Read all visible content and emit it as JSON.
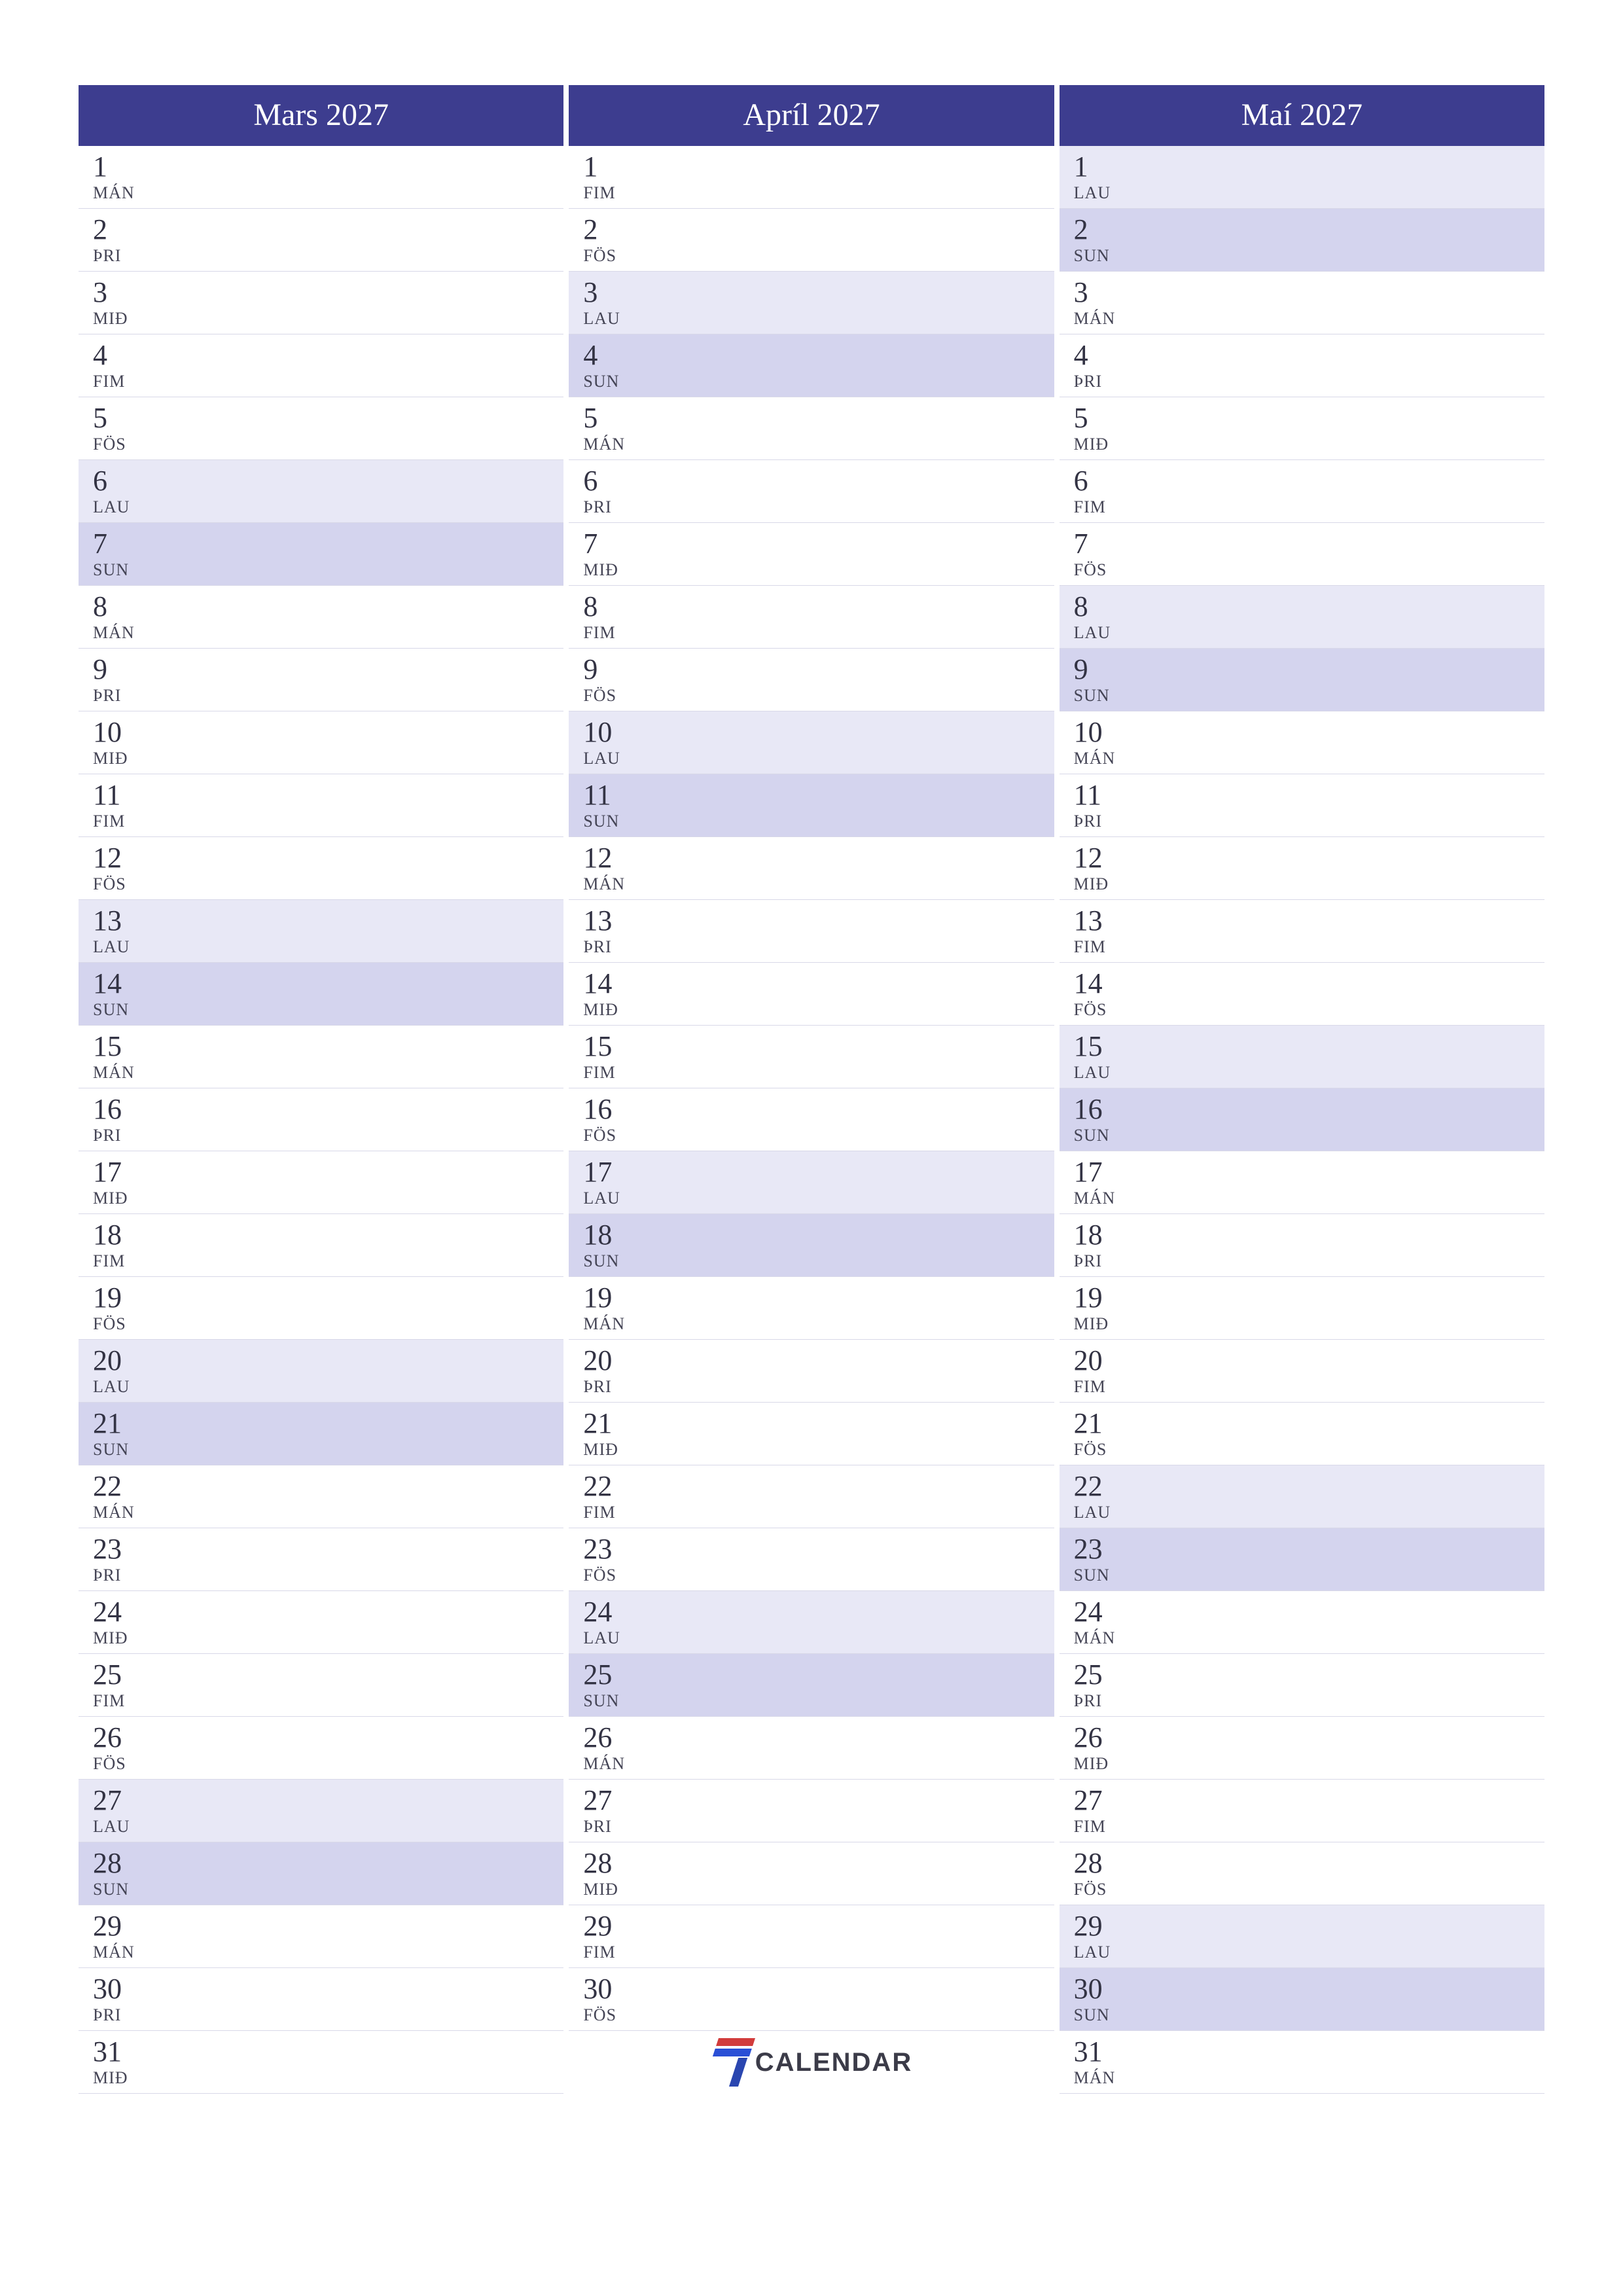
{
  "colors": {
    "header_bg": "#3d3d8f",
    "sat_bg": "#e8e8f6",
    "sun_bg": "#d4d4ee"
  },
  "day_labels": {
    "mon": "MÁN",
    "tue": "ÞRI",
    "wed": "MIÐ",
    "thu": "FIM",
    "fri": "FÖS",
    "sat": "LAU",
    "sun": "SUN"
  },
  "logo_text": "CALENDAR",
  "months": [
    {
      "title": "Mars 2027",
      "days": [
        {
          "n": "1",
          "d": "MÁN",
          "t": "weekday"
        },
        {
          "n": "2",
          "d": "ÞRI",
          "t": "weekday"
        },
        {
          "n": "3",
          "d": "MIÐ",
          "t": "weekday"
        },
        {
          "n": "4",
          "d": "FIM",
          "t": "weekday"
        },
        {
          "n": "5",
          "d": "FÖS",
          "t": "weekday"
        },
        {
          "n": "6",
          "d": "LAU",
          "t": "sat"
        },
        {
          "n": "7",
          "d": "SUN",
          "t": "sun"
        },
        {
          "n": "8",
          "d": "MÁN",
          "t": "weekday"
        },
        {
          "n": "9",
          "d": "ÞRI",
          "t": "weekday"
        },
        {
          "n": "10",
          "d": "MIÐ",
          "t": "weekday"
        },
        {
          "n": "11",
          "d": "FIM",
          "t": "weekday"
        },
        {
          "n": "12",
          "d": "FÖS",
          "t": "weekday"
        },
        {
          "n": "13",
          "d": "LAU",
          "t": "sat"
        },
        {
          "n": "14",
          "d": "SUN",
          "t": "sun"
        },
        {
          "n": "15",
          "d": "MÁN",
          "t": "weekday"
        },
        {
          "n": "16",
          "d": "ÞRI",
          "t": "weekday"
        },
        {
          "n": "17",
          "d": "MIÐ",
          "t": "weekday"
        },
        {
          "n": "18",
          "d": "FIM",
          "t": "weekday"
        },
        {
          "n": "19",
          "d": "FÖS",
          "t": "weekday"
        },
        {
          "n": "20",
          "d": "LAU",
          "t": "sat"
        },
        {
          "n": "21",
          "d": "SUN",
          "t": "sun"
        },
        {
          "n": "22",
          "d": "MÁN",
          "t": "weekday"
        },
        {
          "n": "23",
          "d": "ÞRI",
          "t": "weekday"
        },
        {
          "n": "24",
          "d": "MIÐ",
          "t": "weekday"
        },
        {
          "n": "25",
          "d": "FIM",
          "t": "weekday"
        },
        {
          "n": "26",
          "d": "FÖS",
          "t": "weekday"
        },
        {
          "n": "27",
          "d": "LAU",
          "t": "sat"
        },
        {
          "n": "28",
          "d": "SUN",
          "t": "sun"
        },
        {
          "n": "29",
          "d": "MÁN",
          "t": "weekday"
        },
        {
          "n": "30",
          "d": "ÞRI",
          "t": "weekday"
        },
        {
          "n": "31",
          "d": "MIÐ",
          "t": "weekday"
        }
      ]
    },
    {
      "title": "Apríl 2027",
      "days": [
        {
          "n": "1",
          "d": "FIM",
          "t": "weekday"
        },
        {
          "n": "2",
          "d": "FÖS",
          "t": "weekday"
        },
        {
          "n": "3",
          "d": "LAU",
          "t": "sat"
        },
        {
          "n": "4",
          "d": "SUN",
          "t": "sun"
        },
        {
          "n": "5",
          "d": "MÁN",
          "t": "weekday"
        },
        {
          "n": "6",
          "d": "ÞRI",
          "t": "weekday"
        },
        {
          "n": "7",
          "d": "MIÐ",
          "t": "weekday"
        },
        {
          "n": "8",
          "d": "FIM",
          "t": "weekday"
        },
        {
          "n": "9",
          "d": "FÖS",
          "t": "weekday"
        },
        {
          "n": "10",
          "d": "LAU",
          "t": "sat"
        },
        {
          "n": "11",
          "d": "SUN",
          "t": "sun"
        },
        {
          "n": "12",
          "d": "MÁN",
          "t": "weekday"
        },
        {
          "n": "13",
          "d": "ÞRI",
          "t": "weekday"
        },
        {
          "n": "14",
          "d": "MIÐ",
          "t": "weekday"
        },
        {
          "n": "15",
          "d": "FIM",
          "t": "weekday"
        },
        {
          "n": "16",
          "d": "FÖS",
          "t": "weekday"
        },
        {
          "n": "17",
          "d": "LAU",
          "t": "sat"
        },
        {
          "n": "18",
          "d": "SUN",
          "t": "sun"
        },
        {
          "n": "19",
          "d": "MÁN",
          "t": "weekday"
        },
        {
          "n": "20",
          "d": "ÞRI",
          "t": "weekday"
        },
        {
          "n": "21",
          "d": "MIÐ",
          "t": "weekday"
        },
        {
          "n": "22",
          "d": "FIM",
          "t": "weekday"
        },
        {
          "n": "23",
          "d": "FÖS",
          "t": "weekday"
        },
        {
          "n": "24",
          "d": "LAU",
          "t": "sat"
        },
        {
          "n": "25",
          "d": "SUN",
          "t": "sun"
        },
        {
          "n": "26",
          "d": "MÁN",
          "t": "weekday"
        },
        {
          "n": "27",
          "d": "ÞRI",
          "t": "weekday"
        },
        {
          "n": "28",
          "d": "MIÐ",
          "t": "weekday"
        },
        {
          "n": "29",
          "d": "FIM",
          "t": "weekday"
        },
        {
          "n": "30",
          "d": "FÖS",
          "t": "weekday"
        }
      ]
    },
    {
      "title": "Maí 2027",
      "days": [
        {
          "n": "1",
          "d": "LAU",
          "t": "sat"
        },
        {
          "n": "2",
          "d": "SUN",
          "t": "sun"
        },
        {
          "n": "3",
          "d": "MÁN",
          "t": "weekday"
        },
        {
          "n": "4",
          "d": "ÞRI",
          "t": "weekday"
        },
        {
          "n": "5",
          "d": "MIÐ",
          "t": "weekday"
        },
        {
          "n": "6",
          "d": "FIM",
          "t": "weekday"
        },
        {
          "n": "7",
          "d": "FÖS",
          "t": "weekday"
        },
        {
          "n": "8",
          "d": "LAU",
          "t": "sat"
        },
        {
          "n": "9",
          "d": "SUN",
          "t": "sun"
        },
        {
          "n": "10",
          "d": "MÁN",
          "t": "weekday"
        },
        {
          "n": "11",
          "d": "ÞRI",
          "t": "weekday"
        },
        {
          "n": "12",
          "d": "MIÐ",
          "t": "weekday"
        },
        {
          "n": "13",
          "d": "FIM",
          "t": "weekday"
        },
        {
          "n": "14",
          "d": "FÖS",
          "t": "weekday"
        },
        {
          "n": "15",
          "d": "LAU",
          "t": "sat"
        },
        {
          "n": "16",
          "d": "SUN",
          "t": "sun"
        },
        {
          "n": "17",
          "d": "MÁN",
          "t": "weekday"
        },
        {
          "n": "18",
          "d": "ÞRI",
          "t": "weekday"
        },
        {
          "n": "19",
          "d": "MIÐ",
          "t": "weekday"
        },
        {
          "n": "20",
          "d": "FIM",
          "t": "weekday"
        },
        {
          "n": "21",
          "d": "FÖS",
          "t": "weekday"
        },
        {
          "n": "22",
          "d": "LAU",
          "t": "sat"
        },
        {
          "n": "23",
          "d": "SUN",
          "t": "sun"
        },
        {
          "n": "24",
          "d": "MÁN",
          "t": "weekday"
        },
        {
          "n": "25",
          "d": "ÞRI",
          "t": "weekday"
        },
        {
          "n": "26",
          "d": "MIÐ",
          "t": "weekday"
        },
        {
          "n": "27",
          "d": "FIM",
          "t": "weekday"
        },
        {
          "n": "28",
          "d": "FÖS",
          "t": "weekday"
        },
        {
          "n": "29",
          "d": "LAU",
          "t": "sat"
        },
        {
          "n": "30",
          "d": "SUN",
          "t": "sun"
        },
        {
          "n": "31",
          "d": "MÁN",
          "t": "weekday"
        }
      ]
    }
  ]
}
